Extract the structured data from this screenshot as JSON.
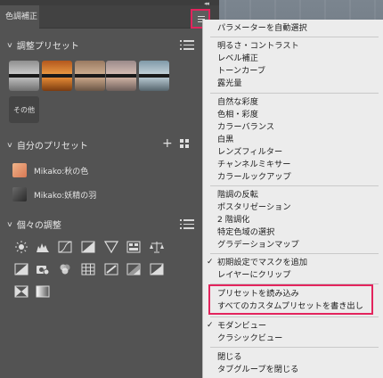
{
  "panel": {
    "tab_label": "色調補正",
    "sections": {
      "presets_title": "調整プリセット",
      "my_presets_title": "自分のプリセット",
      "adjustments_title": "個々の調整"
    },
    "other_label": "その他",
    "my_presets": [
      {
        "label": "Mikako:秋の色"
      },
      {
        "label": "Mikako:妖精の羽"
      }
    ],
    "adjustment_icons": [
      "brightness-contrast-icon",
      "levels-icon",
      "curves-icon",
      "exposure-icon",
      "vibrance-icon",
      "hue-saturation-icon",
      "color-balance-icon",
      "black-white-icon",
      "photo-filter-icon",
      "channel-mixer-icon",
      "color-lookup-icon",
      "invert-icon",
      "posterize-icon",
      "threshold-icon",
      "gradient-map-icon",
      "selective-color-icon"
    ]
  },
  "menu": {
    "items": [
      {
        "label": "パラメーターを自動選択",
        "checked": false
      },
      {
        "label": "明るさ・コントラスト",
        "checked": false
      },
      {
        "label": "レベル補正",
        "checked": false
      },
      {
        "label": "トーンカーブ",
        "checked": false
      },
      {
        "label": "露光量",
        "checked": false
      },
      {
        "label": "自然な彩度",
        "checked": false
      },
      {
        "label": "色相・彩度",
        "checked": false
      },
      {
        "label": "カラーバランス",
        "checked": false
      },
      {
        "label": "白黒",
        "checked": false
      },
      {
        "label": "レンズフィルター",
        "checked": false
      },
      {
        "label": "チャンネルミキサー",
        "checked": false
      },
      {
        "label": "カラールックアップ",
        "checked": false
      },
      {
        "label": "階調の反転",
        "checked": false
      },
      {
        "label": "ポスタリゼーション",
        "checked": false
      },
      {
        "label": "2 階調化",
        "checked": false
      },
      {
        "label": "特定色域の選択",
        "checked": false
      },
      {
        "label": "グラデーションマップ",
        "checked": false
      },
      {
        "label": "初期設定でマスクを追加",
        "checked": true
      },
      {
        "label": "レイヤーにクリップ",
        "checked": false
      },
      {
        "label": "プリセットを読み込み",
        "checked": false
      },
      {
        "label": "すべてのカスタムプリセットを書き出し",
        "checked": false
      },
      {
        "label": "モダンビュー",
        "checked": true
      },
      {
        "label": "クラシックビュー",
        "checked": false
      },
      {
        "label": "閉じる",
        "checked": false
      },
      {
        "label": "タブグループを閉じる",
        "checked": false
      }
    ],
    "check_glyph": "✓",
    "highlight_color": "#e3245d"
  }
}
